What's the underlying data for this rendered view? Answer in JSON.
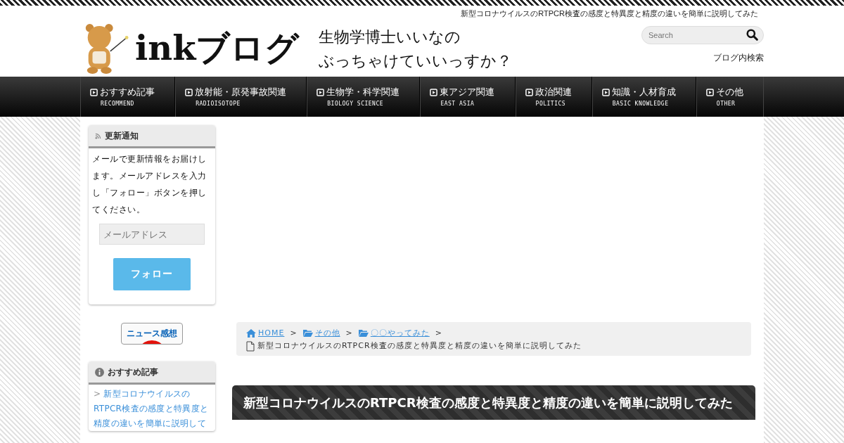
{
  "header": {
    "page_title": "新型コロナウイルスのRTPCR検査の感度と特異度と精度の違いを簡単に説明してみた",
    "logo": {
      "name": "inkブログ",
      "tagline_lines": [
        "生物学博士いいなの",
        "ぶっちゃけていいっすか？"
      ]
    },
    "search": {
      "placeholder": "Search"
    },
    "search_caption": "ブログ内検索"
  },
  "nav": [
    {
      "label": "おすすめ記事",
      "sublabel": "RECOMMEND"
    },
    {
      "label": "放射能・原発事故関連",
      "sublabel": "RADIOISOTOPE"
    },
    {
      "label": "生物学・科学関連",
      "sublabel": "BIOLOGY SCIENCE"
    },
    {
      "label": "東アジア関連",
      "sublabel": "EAST ASIA"
    },
    {
      "label": "政治関連",
      "sublabel": "POLITICS"
    },
    {
      "label": "知識・人材育成",
      "sublabel": "BASIC KNOWLEDGE"
    },
    {
      "label": "その他",
      "sublabel": "OTHER"
    }
  ],
  "sidebar": {
    "subscribe": {
      "title": "更新通知",
      "text": "メールで更新情報をお届けします。メールアドレスを入力し「フォロー」ボタンを押してください。",
      "email_placeholder": "メールアドレス",
      "button": "フォロー"
    },
    "banner": {
      "label": "ニュース感想"
    },
    "recommended": {
      "title": "おすすめ記事",
      "marker": ">",
      "items": [
        "新型コロナウイルスのRTPCR検査の感度と特異度と精度の違いを簡単に説明して"
      ]
    }
  },
  "breadcrumb": {
    "separator": ">",
    "items": [
      {
        "label": "HOME",
        "kind": "home"
      },
      {
        "label": "その他",
        "kind": "folder"
      },
      {
        "label": "〇〇やってみた",
        "kind": "folder"
      },
      {
        "label": "新型コロナウイルスのRTPCR検査の感度と特異度と精度の違いを簡単に説明してみた",
        "kind": "page"
      }
    ]
  },
  "article": {
    "title": "新型コロナウイルスのRTPCR検査の感度と特異度と精度の違いを簡単に説明してみた"
  }
}
